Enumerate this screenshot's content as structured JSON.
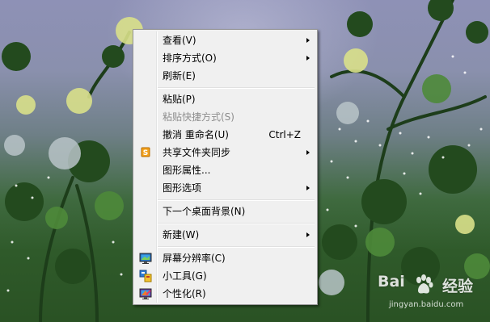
{
  "menu": {
    "items": [
      {
        "label": "查看(V)",
        "submenu": true
      },
      {
        "label": "排序方式(O)",
        "submenu": true
      },
      {
        "label": "刷新(E)"
      },
      {
        "separator": true
      },
      {
        "label": "粘贴(P)"
      },
      {
        "label": "粘贴快捷方式(S)",
        "disabled": true
      },
      {
        "label": "撤消 重命名(U)",
        "shortcut": "Ctrl+Z"
      },
      {
        "label": "共享文件夹同步",
        "submenu": true,
        "icon": "shared-folder-sync-icon"
      },
      {
        "label": "图形属性..."
      },
      {
        "label": "图形选项",
        "submenu": true
      },
      {
        "separator": true
      },
      {
        "label": "下一个桌面背景(N)"
      },
      {
        "separator": true
      },
      {
        "label": "新建(W)",
        "submenu": true
      },
      {
        "separator": true
      },
      {
        "label": "屏幕分辨率(C)",
        "icon": "screen-resolution-icon"
      },
      {
        "label": "小工具(G)",
        "icon": "gadgets-icon"
      },
      {
        "label": "个性化(R)",
        "icon": "personalize-icon"
      }
    ]
  },
  "watermark": {
    "brand": "Bai",
    "product": "经验",
    "url": "jingyan.baidu.com"
  },
  "colors": {
    "menu_bg": "#f0f0f0",
    "menu_border": "#979797",
    "disabled_text": "#8d8d8d",
    "wallpaper_sky": "#8e91b6",
    "wallpaper_grass": "#2f5a2a"
  }
}
